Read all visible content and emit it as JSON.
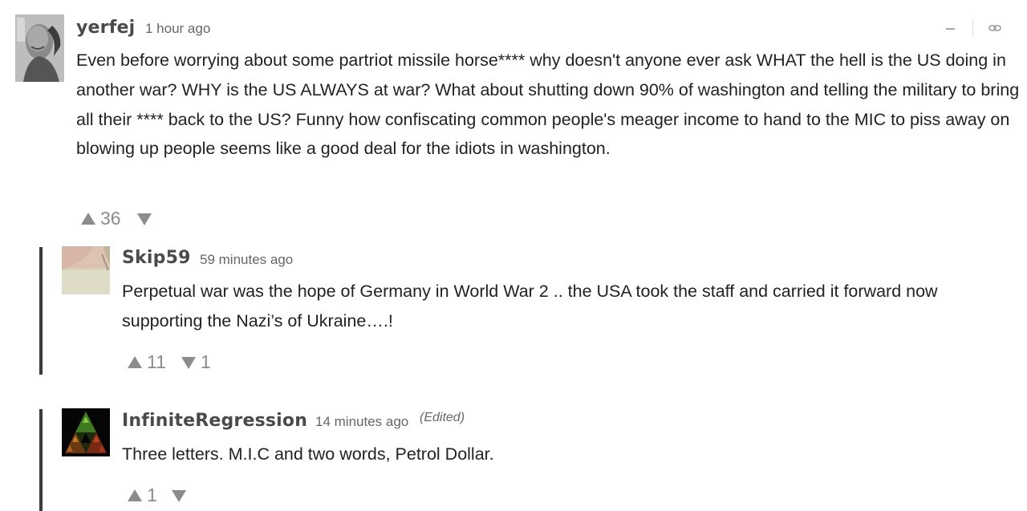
{
  "comments": [
    {
      "username": "yerfej",
      "time": "1 hour ago",
      "body": "Even before worrying about some partriot missile horse**** why doesn't anyone ever ask WHAT the hell is the US doing in another war? WHY is the US ALWAYS at war? What about shutting down 90% of washington and telling the military to bring all their **** back to the US? Funny how confiscating common people's meager income to hand to the MIC to piss away on blowing up people seems like a good deal for the idiots in washington.",
      "upvotes": "36",
      "downvotes": ""
    },
    {
      "username": "Skip59",
      "time": "59 minutes ago",
      "body": "Perpetual war was the hope of Germany in World War 2 .. the USA took the staff and carried it forward now supporting the Nazi’s of Ukraine….!",
      "upvotes": "11",
      "downvotes": "1"
    },
    {
      "username": "InfiniteRegression",
      "time": "14 minutes ago",
      "edited": "(Edited)",
      "body": "Three letters. M.I.C and two words, Petrol Dollar.",
      "upvotes": "1",
      "downvotes": ""
    }
  ],
  "colors": {
    "text": "#222222",
    "username": "#4a4a4a",
    "muted": "#8c8c8c",
    "reply_bar": "#3a3a3a"
  },
  "icons": [
    "minimize-icon",
    "link-icon",
    "upvote-icon",
    "downvote-icon"
  ]
}
